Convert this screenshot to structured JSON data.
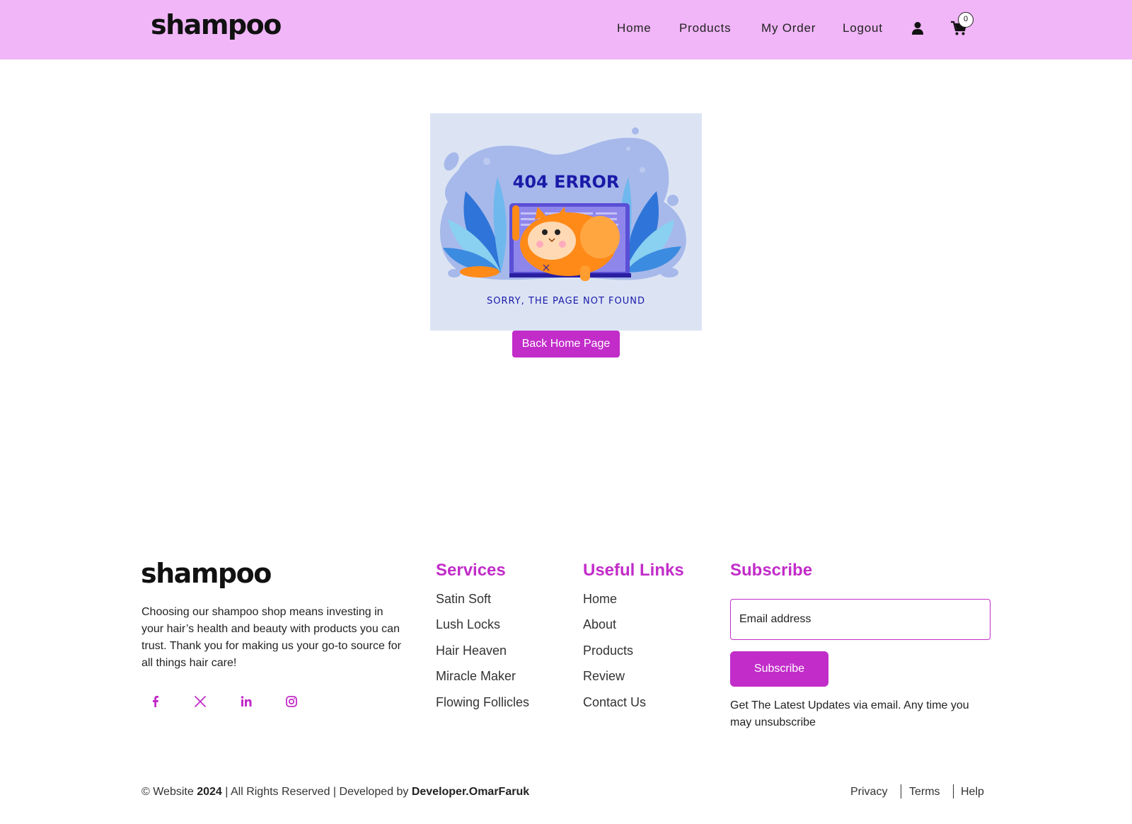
{
  "header": {
    "logo": "shampoo",
    "nav": [
      "Home",
      "Products",
      "My Order",
      "Logout"
    ],
    "cart_count": "0",
    "user_icon": "user-icon",
    "cart_icon": "cart-icon"
  },
  "error": {
    "heading": "404 ERROR",
    "message": "SORRY, THE PAGE NOT FOUND",
    "back_button": "Back Home Page"
  },
  "footer": {
    "logo": "shampoo",
    "about": "Choosing our shampoo shop means investing in your hair’s health and beauty with products you can trust. Thank you for making us your go-to source for all things hair care!",
    "social_icons": [
      "facebook-icon",
      "x-icon",
      "linkedin-icon",
      "instagram-icon"
    ],
    "services": {
      "title": "Services",
      "items": [
        "Satin Soft",
        "Lush Locks",
        "Hair Heaven",
        "Miracle Maker",
        "Flowing Follicles"
      ]
    },
    "useful_links": {
      "title": "Useful Links",
      "items": [
        "Home",
        "About",
        "Products",
        "Review",
        "Contact Us"
      ]
    },
    "subscribe": {
      "title": "Subscribe",
      "placeholder": "Email address",
      "button": "Subscribe",
      "note": "Get The Latest Updates via email. Any time you may unsubscribe"
    },
    "copyright": {
      "prefix": "© Website",
      "year": "2024",
      "middle": "| All Rights Reserved | Developed by",
      "developer": "Developer.OmarFaruk"
    },
    "legal": [
      "Privacy",
      "Terms",
      "Help"
    ]
  },
  "colors": {
    "header_bg": "#f0b6f7",
    "accent": "#c22cc9",
    "error_card_bg": "#dce4f4",
    "error_text": "#1a1aa8"
  }
}
